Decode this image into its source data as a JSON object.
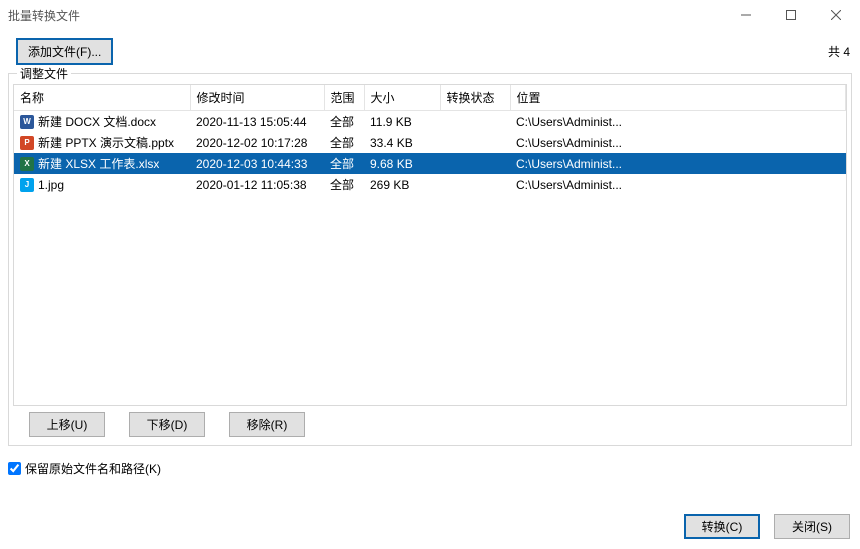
{
  "window": {
    "title": "批量转换文件"
  },
  "toolbar": {
    "add_label": "添加文件(F)...",
    "count_text": "共 4"
  },
  "group": {
    "legend": "调整文件"
  },
  "columns": {
    "name": "名称",
    "mtime": "修改时间",
    "scope": "范围",
    "size": "大小",
    "status": "转换状态",
    "location": "位置"
  },
  "rows": [
    {
      "icon": "docx",
      "name": "新建 DOCX 文档.docx",
      "mtime": "2020-11-13 15:05:44",
      "scope": "全部",
      "size": "11.9 KB",
      "status": "",
      "location": "C:\\Users\\Administ...",
      "selected": false
    },
    {
      "icon": "pptx",
      "name": "新建 PPTX 演示文稿.pptx",
      "mtime": "2020-12-02 10:17:28",
      "scope": "全部",
      "size": "33.4 KB",
      "status": "",
      "location": "C:\\Users\\Administ...",
      "selected": false
    },
    {
      "icon": "xlsx",
      "name": "新建 XLSX 工作表.xlsx",
      "mtime": "2020-12-03 10:44:33",
      "scope": "全部",
      "size": "9.68 KB",
      "status": "",
      "location": "C:\\Users\\Administ...",
      "selected": true
    },
    {
      "icon": "jpg",
      "name": "1.jpg",
      "mtime": "2020-01-12 11:05:38",
      "scope": "全部",
      "size": "269 KB",
      "status": "",
      "location": "C:\\Users\\Administ...",
      "selected": false
    }
  ],
  "list_buttons": {
    "up": "上移(U)",
    "down": "下移(D)",
    "remove": "移除(R)"
  },
  "checkbox": {
    "keep_original_label": "保留原始文件名和路径(K)",
    "checked": true
  },
  "footer": {
    "convert": "转换(C)",
    "close": "关闭(S)"
  }
}
